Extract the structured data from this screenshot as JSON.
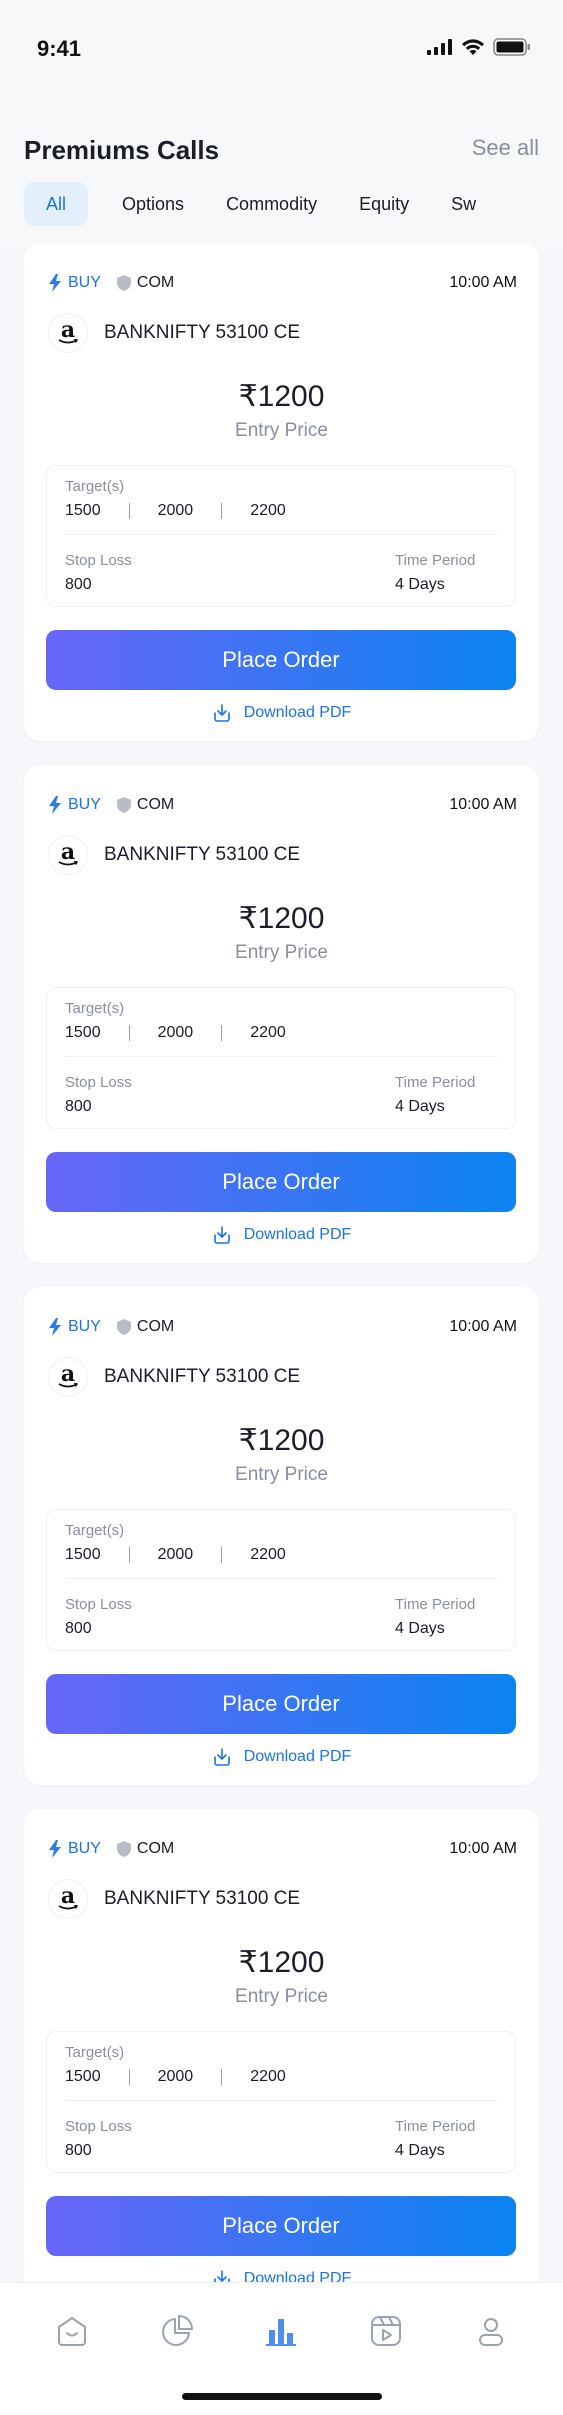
{
  "status": {
    "time": "9:41"
  },
  "header": {
    "title": "Premiums Calls",
    "see_all": "See all"
  },
  "tabs": [
    {
      "label": "All",
      "active": true
    },
    {
      "label": "Options",
      "active": false
    },
    {
      "label": "Commodity",
      "active": false
    },
    {
      "label": "Equity",
      "active": false
    },
    {
      "label": "Sw",
      "active": false
    }
  ],
  "cards": [
    {
      "side": "BUY",
      "segment": "COM",
      "time": "10:00 AM",
      "symbol": "BANKNIFTY 53100 CE",
      "price": "₹1200",
      "entry_label": "Entry Price",
      "targets_label": "Target(s)",
      "targets": [
        "1500",
        "2000",
        "2200"
      ],
      "stoploss_label": "Stop Loss",
      "stoploss": "800",
      "period_label": "Time Period",
      "period": "4 Days",
      "cta": "Place Order",
      "download": "Download PDF"
    },
    {
      "side": "BUY",
      "segment": "COM",
      "time": "10:00 AM",
      "symbol": "BANKNIFTY 53100 CE",
      "price": "₹1200",
      "entry_label": "Entry Price",
      "targets_label": "Target(s)",
      "targets": [
        "1500",
        "2000",
        "2200"
      ],
      "stoploss_label": "Stop Loss",
      "stoploss": "800",
      "period_label": "Time Period",
      "period": "4 Days",
      "cta": "Place Order",
      "download": "Download PDF"
    },
    {
      "side": "BUY",
      "segment": "COM",
      "time": "10:00 AM",
      "symbol": "BANKNIFTY 53100 CE",
      "price": "₹1200",
      "entry_label": "Entry Price",
      "targets_label": "Target(s)",
      "targets": [
        "1500",
        "2000",
        "2200"
      ],
      "stoploss_label": "Stop Loss",
      "stoploss": "800",
      "period_label": "Time Period",
      "period": "4 Days",
      "cta": "Place Order",
      "download": "Download PDF"
    },
    {
      "side": "BUY",
      "segment": "COM",
      "time": "10:00 AM",
      "symbol": "BANKNIFTY 53100 CE",
      "price": "₹1200",
      "entry_label": "Entry Price",
      "targets_label": "Target(s)",
      "targets": [
        "1500",
        "2000",
        "2200"
      ],
      "stoploss_label": "Stop Loss",
      "stoploss": "800",
      "period_label": "Time Period",
      "period": "4 Days",
      "cta": "Place Order",
      "download": "Download PDF"
    }
  ],
  "tabbar": {
    "items": [
      {
        "icon": "home-icon",
        "active": false
      },
      {
        "icon": "pie-chart-icon",
        "active": false
      },
      {
        "icon": "bar-chart-icon",
        "active": true
      },
      {
        "icon": "video-icon",
        "active": false
      },
      {
        "icon": "profile-icon",
        "active": false
      }
    ]
  },
  "colors": {
    "accent": "#1A73E8",
    "gradient_start": "#6866F6",
    "gradient_end": "#0A84F0",
    "muted": "#8A8F9E"
  }
}
